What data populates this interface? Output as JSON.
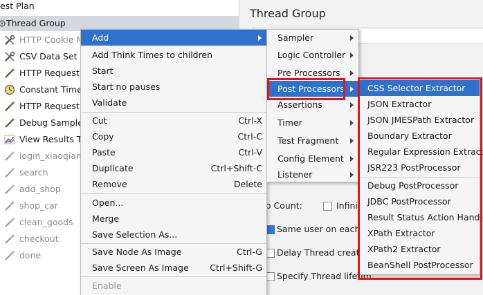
{
  "tree": {
    "items": [
      {
        "label": "est Plan",
        "icon": "test-plan-icon",
        "disabled": false,
        "selected": false
      },
      {
        "label": "Thread Group",
        "icon": "thread-group-icon",
        "disabled": false,
        "selected": true
      },
      {
        "label": "HTTP Cookie Ma",
        "icon": "wrench-icon",
        "disabled": true,
        "selected": false
      },
      {
        "label": "CSV Data Set Co",
        "icon": "wrench-icon",
        "disabled": false,
        "selected": false
      },
      {
        "label": "HTTP Request",
        "icon": "pipette-icon",
        "disabled": false,
        "selected": false
      },
      {
        "label": "Constant Timer",
        "icon": "clock-icon",
        "disabled": false,
        "selected": false
      },
      {
        "label": "HTTP Request",
        "icon": "pipette-icon",
        "disabled": false,
        "selected": false
      },
      {
        "label": "Debug Sampler",
        "icon": "pipette-icon",
        "disabled": false,
        "selected": false
      },
      {
        "label": "View Results Tre",
        "icon": "graph-icon",
        "disabled": false,
        "selected": false
      },
      {
        "label": "login_xiaoqiang",
        "icon": "pipette-icon",
        "disabled": true,
        "selected": false
      },
      {
        "label": "search",
        "icon": "pipette-icon",
        "disabled": true,
        "selected": false
      },
      {
        "label": "add_shop",
        "icon": "pipette-icon",
        "disabled": true,
        "selected": false
      },
      {
        "label": "shop_car",
        "icon": "pipette-icon",
        "disabled": true,
        "selected": false
      },
      {
        "label": "clean_goods",
        "icon": "pipette-icon",
        "disabled": true,
        "selected": false
      },
      {
        "label": "checkout",
        "icon": "pipette-icon",
        "disabled": true,
        "selected": false
      },
      {
        "label": "done",
        "icon": "pipette-icon",
        "disabled": true,
        "selected": false
      }
    ]
  },
  "right_panel": {
    "title": "Thread Group",
    "loop_count_label": "op Count:",
    "infinite_label": "Infinit",
    "same_user_label": "Same user on each it",
    "delay_label": "Delay Thread creatio",
    "lifetime_label": "Specify Thread lifetim"
  },
  "context_menu": {
    "add": "Add",
    "add_think_times": "Add Think Times to children",
    "start": "Start",
    "start_no_pauses": "Start no pauses",
    "validate": "Validate",
    "cut": "Cut",
    "cut_key": "Ctrl-X",
    "copy": "Copy",
    "copy_key": "Ctrl-C",
    "paste": "Paste",
    "paste_key": "Ctrl-V",
    "duplicate": "Duplicate",
    "duplicate_key": "Ctrl+Shift-C",
    "remove": "Remove",
    "remove_key": "Delete",
    "open": "Open...",
    "merge": "Merge",
    "save_selection": "Save Selection As...",
    "save_node_image": "Save Node As Image",
    "save_node_image_key": "Ctrl-G",
    "save_screen_image": "Save Screen As Image",
    "save_screen_image_key": "Ctrl+Shift-G",
    "enable": "Enable"
  },
  "add_submenu": {
    "sampler": "Sampler",
    "logic_controller": "Logic Controller",
    "pre_processors": "Pre Processors",
    "post_processors": "Post Processors",
    "assertions": "Assertions",
    "timer": "Timer",
    "test_fragment": "Test Fragment",
    "config_element": "Config Element",
    "listener": "Listener"
  },
  "post_processors_menu": {
    "items_group1": [
      "CSS Selector Extractor",
      "JSON Extractor",
      "JSON JMESPath Extractor",
      "Boundary Extractor",
      "Regular Expression Extractor",
      "JSR223 PostProcessor"
    ],
    "items_group2": [
      "Debug PostProcessor",
      "JDBC PostProcessor",
      "Result Status Action Handler",
      "XPath Extractor",
      "XPath2 Extractor",
      "BeanShell PostProcessor"
    ]
  },
  "colors": {
    "highlight": "#2f72cd",
    "annotation_red": "#e0141e",
    "selected_row": "#d5d9de"
  }
}
